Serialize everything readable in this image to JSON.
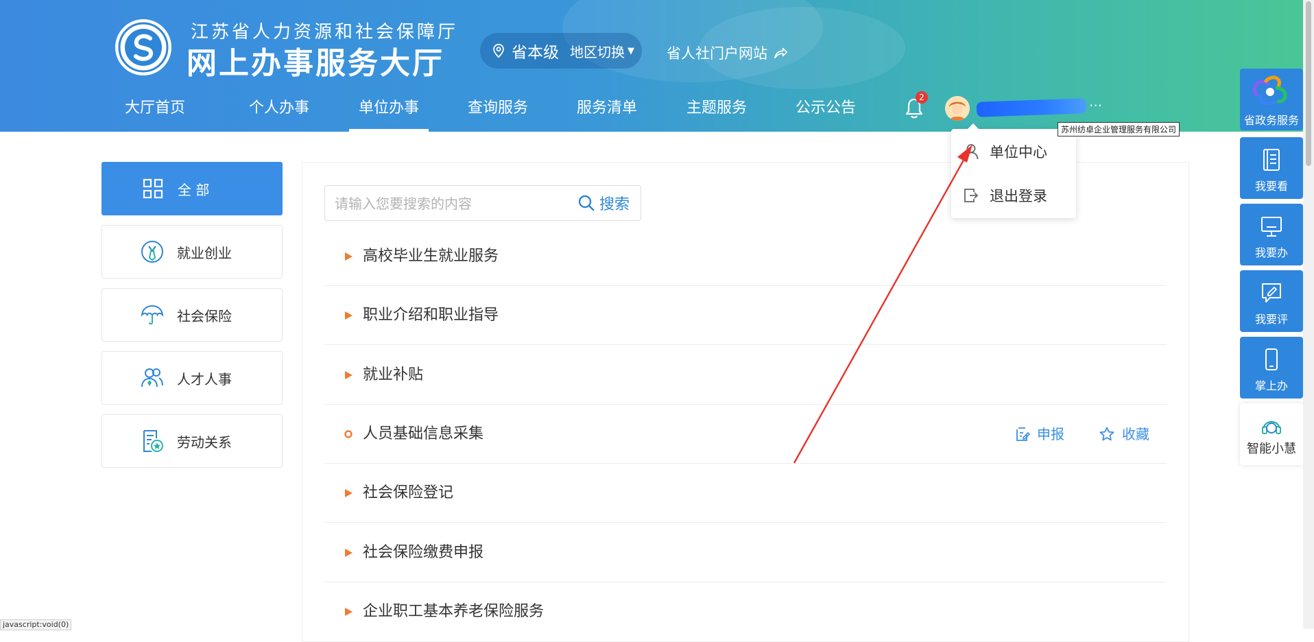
{
  "header": {
    "subtitle": "江苏省人力资源和社会保障厅",
    "title": "网上办事服务大厅",
    "region_level": "省本级",
    "region_switch": "地区切换",
    "portal_link": "省人社门户网站",
    "logo_icon": "hrss-logo-icon"
  },
  "nav": {
    "items": [
      {
        "label": "大厅首页"
      },
      {
        "label": "个人办事"
      },
      {
        "label": "单位办事",
        "active": true
      },
      {
        "label": "查询服务"
      },
      {
        "label": "服务清单"
      },
      {
        "label": "主题服务"
      },
      {
        "label": "公示公告"
      }
    ],
    "notification_count": "2",
    "user_dots": "···",
    "user_tooltip": "苏州纺卓企业管理服务有限公司"
  },
  "user_menu": {
    "items": [
      {
        "label": "单位中心",
        "icon": "user-icon"
      },
      {
        "label": "退出登录",
        "icon": "logout-icon"
      }
    ]
  },
  "sidebar": {
    "items": [
      {
        "label": "全 部",
        "icon": "grid-icon",
        "active": true
      },
      {
        "label": "就业创业",
        "icon": "employment-icon"
      },
      {
        "label": "社会保险",
        "icon": "umbrella-icon"
      },
      {
        "label": "人才人事",
        "icon": "people-icon"
      },
      {
        "label": "劳动关系",
        "icon": "contract-icon"
      }
    ]
  },
  "search": {
    "placeholder": "请输入您要搜索的内容",
    "button_label": "搜索"
  },
  "services": [
    {
      "label": "高校毕业生就业服务",
      "expandable": true
    },
    {
      "label": "职业介绍和职业指导",
      "expandable": true
    },
    {
      "label": "就业补贴",
      "expandable": true
    },
    {
      "label": "人员基础信息采集",
      "expandable": false,
      "actions": {
        "apply": "申报",
        "favorite": "收藏"
      }
    },
    {
      "label": "社会保险登记",
      "expandable": true
    },
    {
      "label": "社会保险缴费申报",
      "expandable": true
    },
    {
      "label": "企业职工基本养老保险服务",
      "expandable": true
    }
  ],
  "float_bar": {
    "items": [
      {
        "label": "省政务服务",
        "icon": "gov-service-logo-icon"
      },
      {
        "label": "我要看",
        "icon": "notebook-icon"
      },
      {
        "label": "我要办",
        "icon": "monitor-icon"
      },
      {
        "label": "我要评",
        "icon": "comment-edit-icon"
      },
      {
        "label": "掌上办",
        "icon": "mobile-icon"
      },
      {
        "label": "智能小慧",
        "icon": "headset-icon"
      }
    ]
  },
  "status_bar": "javascript:void(0)",
  "colors": {
    "primary": "#3a8ee6",
    "accent_orange": "#f07c32",
    "badge_red": "#e53935",
    "annotation_arrow": "#e8322b"
  }
}
